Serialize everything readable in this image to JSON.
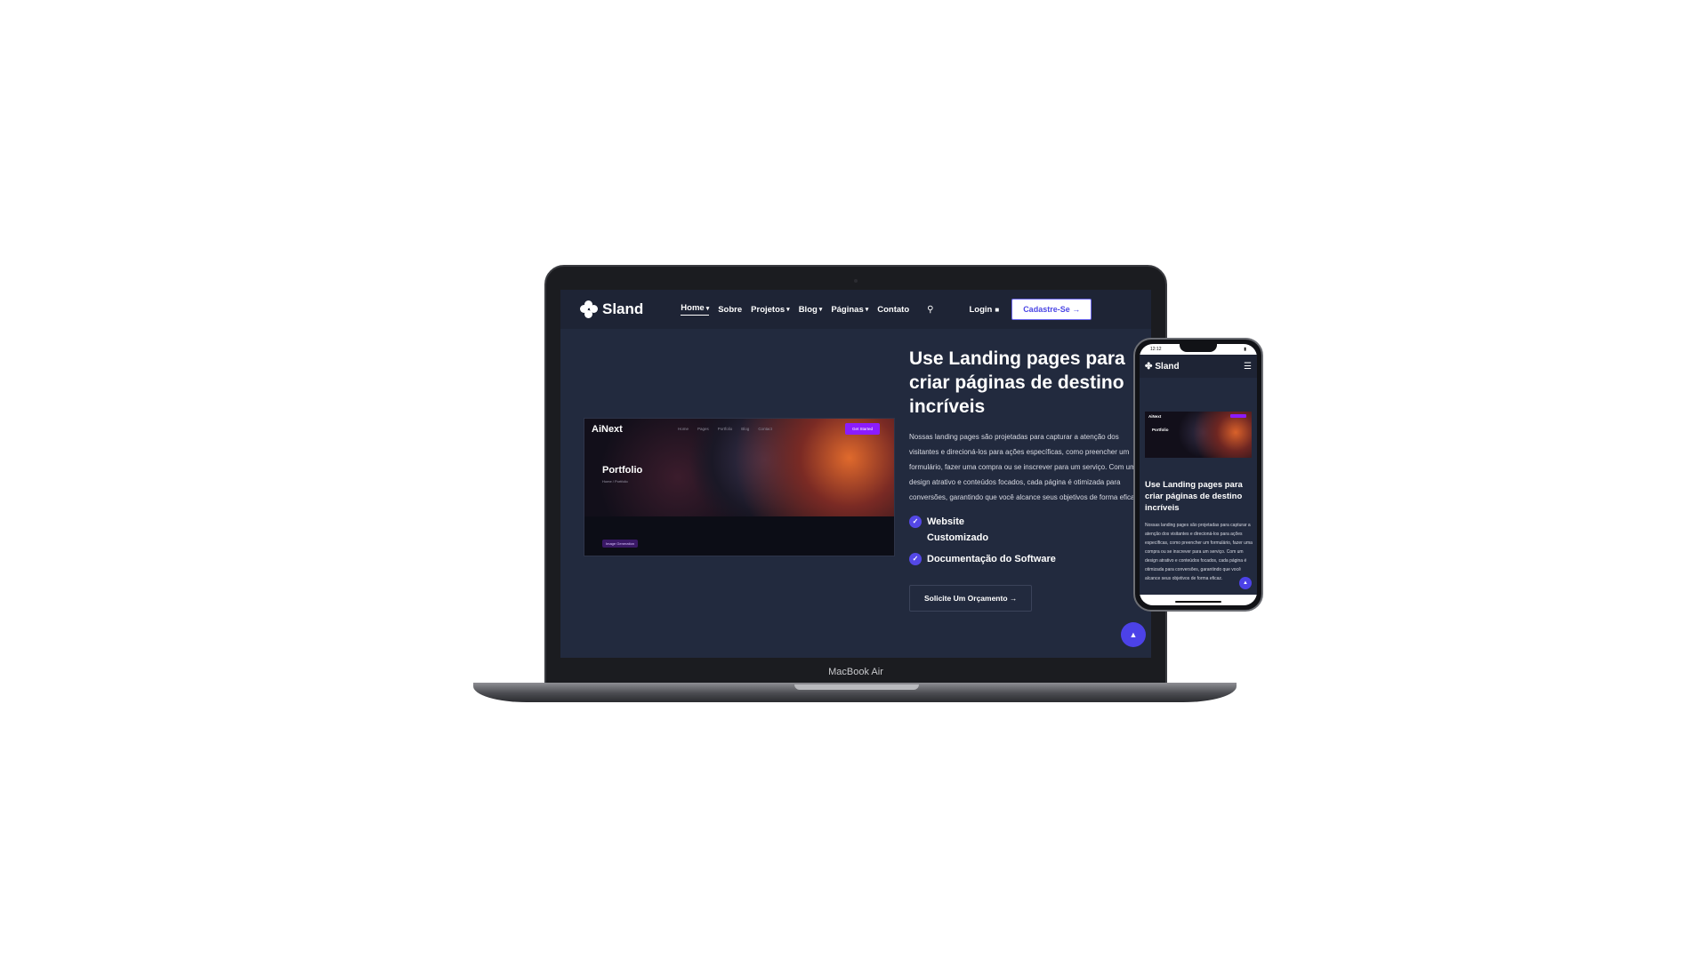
{
  "site": {
    "brand": "Sland",
    "nav": {
      "links": [
        {
          "label": "Home",
          "caret": true
        },
        {
          "label": "Sobre",
          "caret": false
        },
        {
          "label": "Projetos",
          "caret": true
        },
        {
          "label": "Blog",
          "caret": true
        },
        {
          "label": "Páginas",
          "caret": true
        },
        {
          "label": "Contato",
          "caret": false
        }
      ],
      "login_label": "Login",
      "cta_label": "Cadastre-Se"
    },
    "hero": {
      "title": "Use Landing pages para criar páginas de destino incríveis",
      "text": "Nossas landing pages são projetadas para capturar a atenção dos visitantes e direcioná-los para ações específicas, como preencher um formulário, fazer uma compra ou se inscrever para um serviço. Com um design atrativo e conteúdos focados, cada página é otimizada para conversões, garantindo que você alcance seus objetivos de forma eficaz.",
      "checks": [
        "Website Customizado",
        "Documentação do Software"
      ],
      "button_label": "Solicite Um Orçamento"
    },
    "preview": {
      "brand": "AiNext",
      "menu": [
        "Home",
        "Pages",
        "Portfolio",
        "Blog",
        "Contact"
      ],
      "cta": "Get Started",
      "title": "Portfolio",
      "crumb": "Home / Portfolio",
      "tag": "Image Generation"
    }
  },
  "device": {
    "laptop_model": "MacBook Air",
    "phone_time": "12:12"
  },
  "colors": {
    "accent": "#5448e6",
    "page_bg": "#222a3e",
    "nav_bg": "#1e2435"
  }
}
